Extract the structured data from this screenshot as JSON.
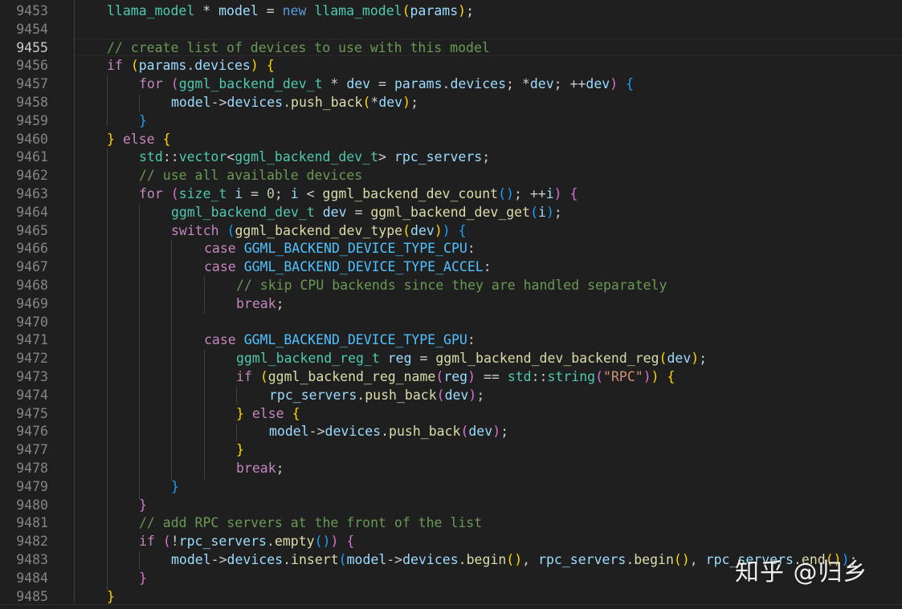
{
  "editor": {
    "active_line": "9455",
    "colors": {
      "background": "#1f1f1f",
      "line_number": "#858585",
      "keyword": "#569cd6",
      "control": "#c586c0",
      "type": "#4ec9b0",
      "function": "#dcdcaa",
      "variable": "#9cdcfe",
      "string": "#ce9178",
      "comment": "#6a9955",
      "enum_member": "#4fc1ff"
    },
    "line_numbers": [
      "9453",
      "9454",
      "9455",
      "9456",
      "9457",
      "9458",
      "9459",
      "9460",
      "9461",
      "9462",
      "9463",
      "9464",
      "9465",
      "9466",
      "9467",
      "9468",
      "9469",
      "9470",
      "9471",
      "9472",
      "9473",
      "9474",
      "9475",
      "9476",
      "9477",
      "9478",
      "9479",
      "9480",
      "9481",
      "9482",
      "9483",
      "9484",
      "9485"
    ],
    "code": {
      "l9453": {
        "v1": "llama_model",
        "op1": " * ",
        "v2": "model",
        "op2": " = ",
        "k1": "new",
        "f1": "llama_model",
        "v3": "params",
        "end": ";"
      },
      "l9455": "// create list of devices to use with this model",
      "l9456": {
        "k": "if",
        "v1": "params",
        "v2": "devices"
      },
      "l9457": {
        "k": "for",
        "t": "ggml_backend_dev_t",
        "v1": "dev",
        "v2": "params",
        "v3": "devices",
        "v4": "dev",
        "v5": "dev"
      },
      "l9458": {
        "v1": "model",
        "v2": "devices",
        "f": "push_back",
        "v3": "dev"
      },
      "l9460": {
        "k": "else"
      },
      "l9461": {
        "ns": "std",
        "t1": "vector",
        "t2": "ggml_backend_dev_t",
        "v": "rpc_servers"
      },
      "l9462": "// use all available devices",
      "l9463": {
        "k": "for",
        "t": "size_t",
        "v1": "i",
        "n": "0",
        "v2": "i",
        "f": "ggml_backend_dev_count",
        "v3": "i"
      },
      "l9464": {
        "t": "ggml_backend_dev_t",
        "v1": "dev",
        "f": "ggml_backend_dev_get",
        "v2": "i"
      },
      "l9465": {
        "k": "switch",
        "f": "ggml_backend_dev_type",
        "v": "dev"
      },
      "l9466": {
        "k": "case",
        "e": "GGML_BACKEND_DEVICE_TYPE_CPU"
      },
      "l9467": {
        "k": "case",
        "e": "GGML_BACKEND_DEVICE_TYPE_ACCEL"
      },
      "l9468": "// skip CPU backends since they are handled separately",
      "l9469": {
        "k": "break"
      },
      "l9471": {
        "k": "case",
        "e": "GGML_BACKEND_DEVICE_TYPE_GPU"
      },
      "l9472": {
        "t": "ggml_backend_reg_t",
        "v1": "reg",
        "f": "ggml_backend_dev_backend_reg",
        "v2": "dev"
      },
      "l9473": {
        "k": "if",
        "f": "ggml_backend_reg_name",
        "v": "reg",
        "ns": "std",
        "t": "string",
        "s": "\"RPC\""
      },
      "l9474": {
        "v1": "rpc_servers",
        "f": "push_back",
        "v2": "dev"
      },
      "l9475": {
        "k": "else"
      },
      "l9476": {
        "v1": "model",
        "v2": "devices",
        "f": "push_back",
        "v3": "dev"
      },
      "l9478": {
        "k": "break"
      },
      "l9481": "// add RPC servers at the front of the list",
      "l9482": {
        "k": "if",
        "v": "rpc_servers",
        "f": "empty"
      },
      "l9483": {
        "v1": "model",
        "v2": "devices",
        "f1": "insert",
        "v3": "model",
        "v4": "devices",
        "f2": "begin",
        "v5": "rpc_servers",
        "f3": "begin",
        "v6": "rpc_servers",
        "f4": "end"
      }
    }
  },
  "watermark": {
    "text": "知乎 @归乡"
  }
}
